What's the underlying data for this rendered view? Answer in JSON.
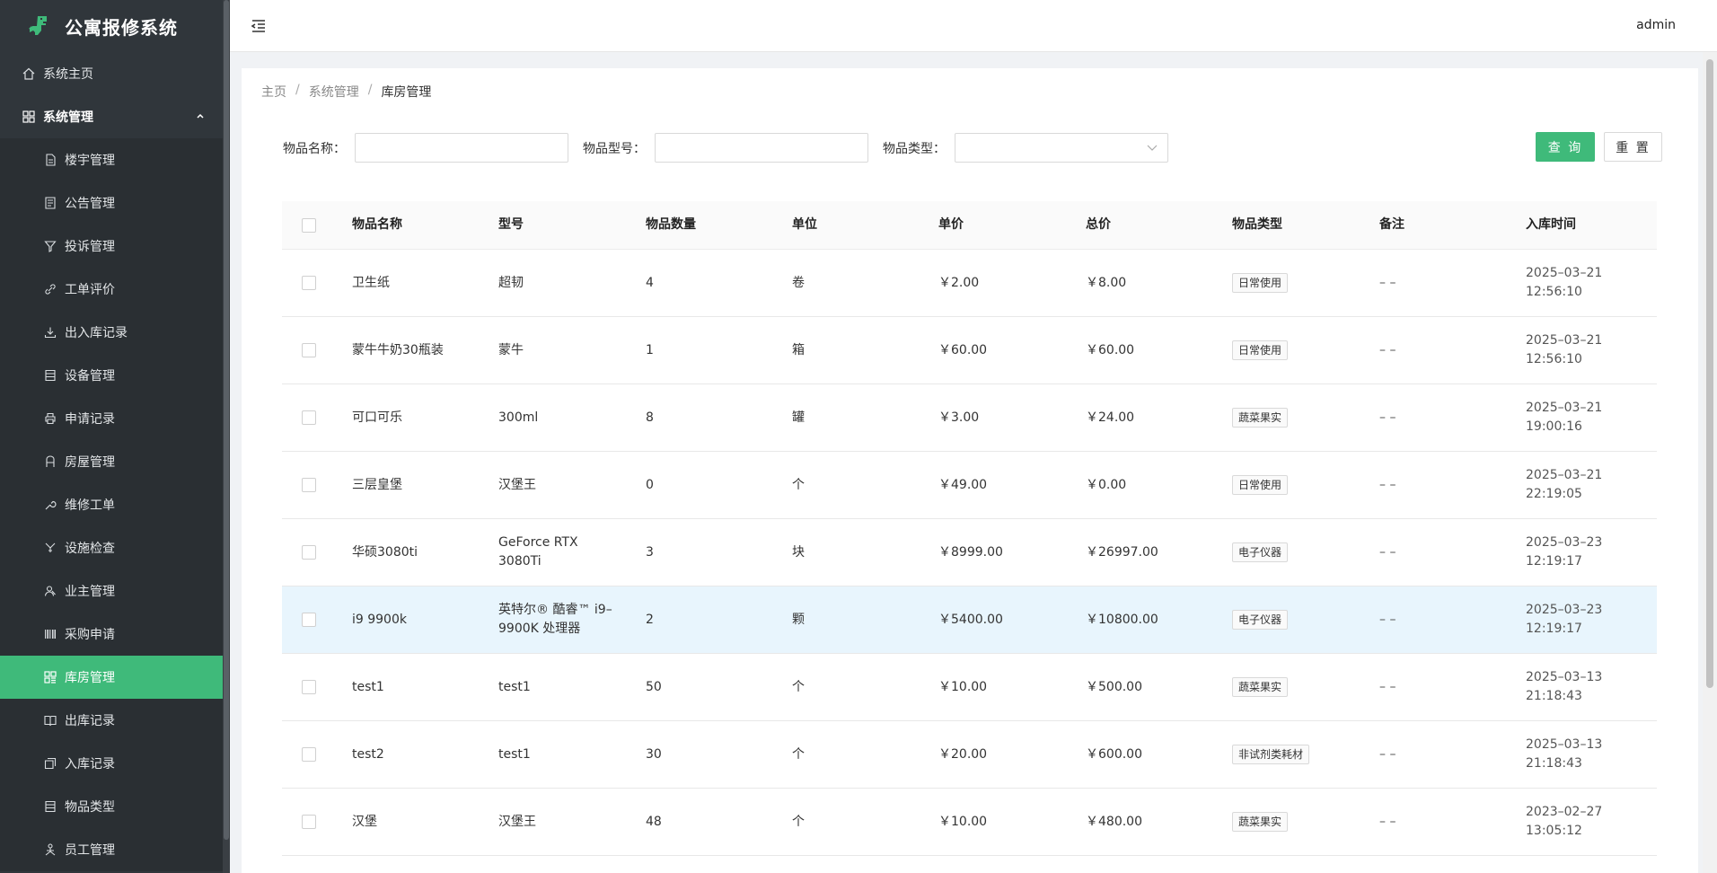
{
  "app": {
    "title": "公寓报修系统",
    "user": "admin"
  },
  "sidebar": {
    "home": "系统主页",
    "group": "系统管理",
    "items": [
      {
        "label": "楼宇管理",
        "icon": "file-icon"
      },
      {
        "label": "公告管理",
        "icon": "document-icon"
      },
      {
        "label": "投诉管理",
        "icon": "filter-icon"
      },
      {
        "label": "工单评价",
        "icon": "link-icon"
      },
      {
        "label": "出入库记录",
        "icon": "download-icon"
      },
      {
        "label": "设备管理",
        "icon": "list-icon"
      },
      {
        "label": "申请记录",
        "icon": "printer-icon"
      },
      {
        "label": "房屋管理",
        "icon": "house-icon"
      },
      {
        "label": "维修工单",
        "icon": "wrench-icon"
      },
      {
        "label": "设施检查",
        "icon": "check-icon"
      },
      {
        "label": "业主管理",
        "icon": "user-icon"
      },
      {
        "label": "采购申请",
        "icon": "barcode-icon"
      },
      {
        "label": "库房管理",
        "icon": "grid-icon",
        "active": true
      },
      {
        "label": "出库记录",
        "icon": "book-icon"
      },
      {
        "label": "入库记录",
        "icon": "copy-icon"
      },
      {
        "label": "物品类型",
        "icon": "list-icon"
      },
      {
        "label": "员工管理",
        "icon": "staff-icon"
      }
    ]
  },
  "breadcrumb": {
    "home": "主页",
    "section": "系统管理",
    "current": "库房管理"
  },
  "filters": {
    "name_label": "物品名称：",
    "name_value": "",
    "model_label": "物品型号：",
    "model_value": "",
    "type_label": "物品类型：",
    "type_value": "",
    "query_button": "查 询",
    "reset_button": "重 置"
  },
  "table": {
    "columns": [
      "物品名称",
      "型号",
      "物品数量",
      "单位",
      "单价",
      "总价",
      "物品类型",
      "备注",
      "入库时间"
    ],
    "rows": [
      {
        "name": "卫生纸",
        "model": "超韧",
        "qty": "4",
        "unit": "卷",
        "price": "￥2.00",
        "total": "￥8.00",
        "type": "日常使用",
        "note": "– –",
        "date": "2025–03–21",
        "time": "12:56:10"
      },
      {
        "name": "蒙牛牛奶30瓶装",
        "model": "蒙牛",
        "qty": "1",
        "unit": "箱",
        "price": "￥60.00",
        "total": "￥60.00",
        "type": "日常使用",
        "note": "– –",
        "date": "2025–03–21",
        "time": "12:56:10"
      },
      {
        "name": "可口可乐",
        "model": "300ml",
        "qty": "8",
        "unit": "罐",
        "price": "￥3.00",
        "total": "￥24.00",
        "type": "蔬菜果实",
        "note": "– –",
        "date": "2025–03–21",
        "time": "19:00:16"
      },
      {
        "name": "三层皇堡",
        "model": "汉堡王",
        "qty": "0",
        "unit": "个",
        "price": "￥49.00",
        "total": "￥0.00",
        "type": "日常使用",
        "note": "– –",
        "date": "2025–03–21",
        "time": "22:19:05"
      },
      {
        "name": "华硕3080ti",
        "model": "GeForce RTX 3080Ti",
        "qty": "3",
        "unit": "块",
        "price": "￥8999.00",
        "total": "￥26997.00",
        "type": "电子仪器",
        "note": "– –",
        "date": "2025–03–23",
        "time": "12:19:17"
      },
      {
        "name": "i9 9900k",
        "model": "英特尔® 酷睿™ i9–9900K 处理器",
        "qty": "2",
        "unit": "颗",
        "price": "￥5400.00",
        "total": "￥10800.00",
        "type": "电子仪器",
        "note": "– –",
        "date": "2025–03–23",
        "time": "12:19:17",
        "highlight": true
      },
      {
        "name": "test1",
        "model": "test1",
        "qty": "50",
        "unit": "个",
        "price": "￥10.00",
        "total": "￥500.00",
        "type": "蔬菜果实",
        "note": "– –",
        "date": "2025–03–13",
        "time": "21:18:43"
      },
      {
        "name": "test2",
        "model": "test1",
        "qty": "30",
        "unit": "个",
        "price": "￥20.00",
        "total": "￥600.00",
        "type": "非试剂类耗材",
        "note": "– –",
        "date": "2025–03–13",
        "time": "21:18:43"
      },
      {
        "name": "汉堡",
        "model": "汉堡王",
        "qty": "48",
        "unit": "个",
        "price": "￥10.00",
        "total": "￥480.00",
        "type": "蔬菜果实",
        "note": "– –",
        "date": "2023–02–27",
        "time": "13:05:12"
      }
    ]
  },
  "colors": {
    "accent": "#3fba7a",
    "sidebar": "#30363b",
    "row_highlight": "#e8f5fd"
  }
}
